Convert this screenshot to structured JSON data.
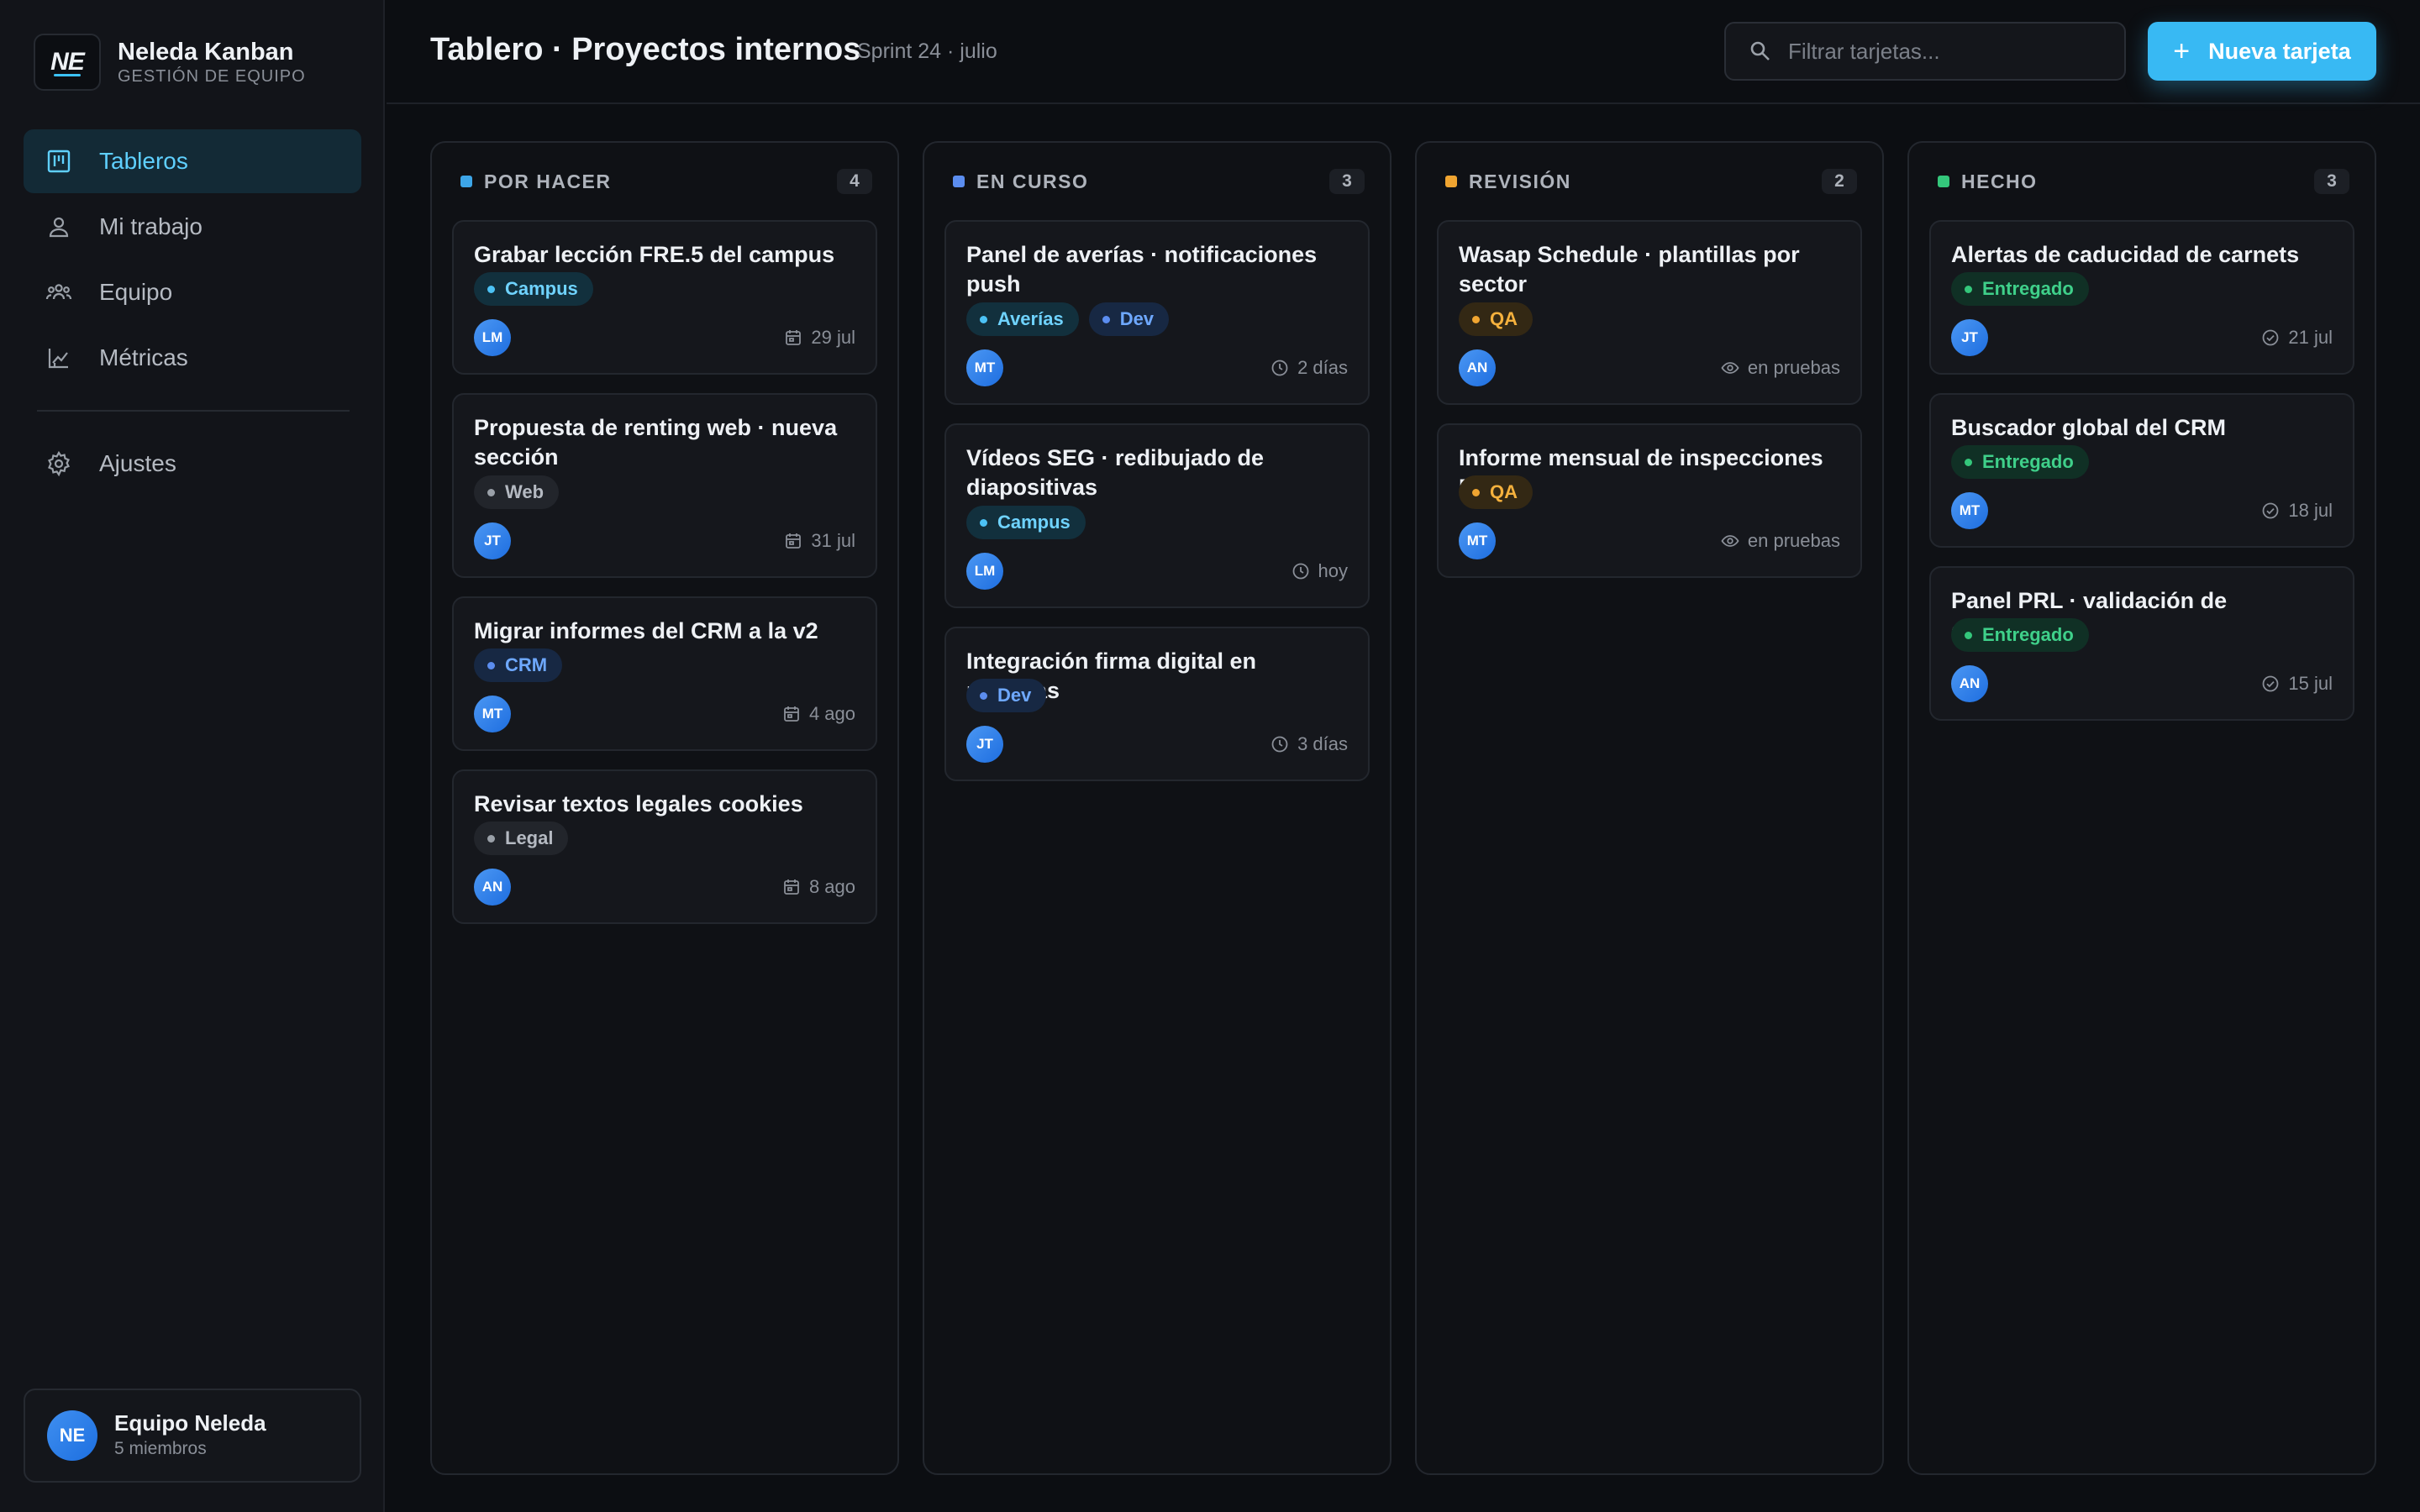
{
  "app": {
    "name": "Neleda Kanban",
    "subtitle": "GESTIÓN DE EQUIPO",
    "logo": "NE"
  },
  "nav": {
    "items": [
      {
        "label": "Tableros",
        "icon": "board-icon",
        "active": true
      },
      {
        "label": "Mi trabajo",
        "icon": "user-icon"
      },
      {
        "label": "Equipo",
        "icon": "team-icon"
      },
      {
        "label": "Métricas",
        "icon": "chart-icon"
      }
    ],
    "settings": {
      "label": "Ajustes",
      "icon": "gear-icon"
    }
  },
  "team": {
    "initials": "NE",
    "name": "Equipo Neleda",
    "members": "5 miembros"
  },
  "header": {
    "title": "Tablero · Proyectos internos",
    "subtitle": "Sprint 24 · julio",
    "search_placeholder": "Filtrar tarjetas...",
    "new_button": "Nueva tarjeta",
    "new_icon": "+"
  },
  "colors": {
    "accent": "#38b9f3",
    "todo": "#3da6e8",
    "progress": "#5b8def",
    "review": "#f0a531",
    "done": "#34c77b"
  },
  "columns": [
    {
      "title": "POR HACER",
      "count": "4",
      "color": "#3da6e8",
      "cards": [
        {
          "title": "Grabar lección FRE.5 del campus",
          "tags": [
            {
              "label": "Campus",
              "kind": "campus"
            }
          ],
          "avatar": "LM",
          "meta_icon": "calendar-icon",
          "meta": "29 jul"
        },
        {
          "title": "Propuesta de renting web · nueva sección",
          "tags": [
            {
              "label": "Web",
              "kind": "neutral"
            }
          ],
          "avatar": "JT",
          "meta_icon": "calendar-icon",
          "meta": "31 jul"
        },
        {
          "title": "Migrar informes del CRM a la v2",
          "tags": [
            {
              "label": "CRM",
              "kind": "blue"
            }
          ],
          "avatar": "MT",
          "meta_icon": "calendar-icon",
          "meta": "4 ago"
        },
        {
          "title": "Revisar textos legales cookies",
          "tags": [
            {
              "label": "Legal",
              "kind": "neutral"
            }
          ],
          "avatar": "AN",
          "meta_icon": "calendar-icon",
          "meta": "8 ago"
        }
      ]
    },
    {
      "title": "EN CURSO",
      "count": "3",
      "color": "#5b8def",
      "cards": [
        {
          "title": "Panel de averías · notificaciones push",
          "tags": [
            {
              "label": "Averías",
              "kind": "campus"
            },
            {
              "label": "Dev",
              "kind": "blue"
            }
          ],
          "avatar": "MT",
          "meta_icon": "clock-icon",
          "meta": "2 días"
        },
        {
          "title": "Vídeos SEG · redibujado de diapositivas",
          "tags": [
            {
              "label": "Campus",
              "kind": "campus"
            }
          ],
          "avatar": "LM",
          "meta_icon": "clock-icon",
          "meta": "hoy"
        },
        {
          "title": "Integración firma digital en nóminas",
          "tags": [
            {
              "label": "Dev",
              "kind": "blue"
            }
          ],
          "avatar": "JT",
          "meta_icon": "clock-icon",
          "meta": "3 días"
        }
      ]
    },
    {
      "title": "REVISIÓN",
      "count": "2",
      "color": "#f0a531",
      "cards": [
        {
          "title": "Wasap Schedule · plantillas por sector",
          "tags": [
            {
              "label": "QA",
              "kind": "qa"
            }
          ],
          "avatar": "AN",
          "meta_icon": "eye-icon",
          "meta": "en pruebas"
        },
        {
          "title": "Informe mensual de inspecciones PDF",
          "tags": [
            {
              "label": "QA",
              "kind": "qa"
            }
          ],
          "avatar": "MT",
          "meta_icon": "eye-icon",
          "meta": "en pruebas"
        }
      ]
    },
    {
      "title": "HECHO",
      "count": "3",
      "color": "#34c77b",
      "cards": [
        {
          "title": "Alertas de caducidad de carnets",
          "tags": [
            {
              "label": "Entregado",
              "kind": "done"
            }
          ],
          "avatar": "JT",
          "meta_icon": "check-circle-icon",
          "meta": "21 jul"
        },
        {
          "title": "Buscador global del CRM",
          "tags": [
            {
              "label": "Entregado",
              "kind": "done"
            }
          ],
          "avatar": "MT",
          "meta_icon": "check-circle-icon",
          "meta": "18 jul"
        },
        {
          "title": "Panel PRL · validación de documentos",
          "tags": [
            {
              "label": "Entregado",
              "kind": "done"
            }
          ],
          "avatar": "AN",
          "meta_icon": "check-circle-icon",
          "meta": "15 jul"
        }
      ]
    }
  ]
}
